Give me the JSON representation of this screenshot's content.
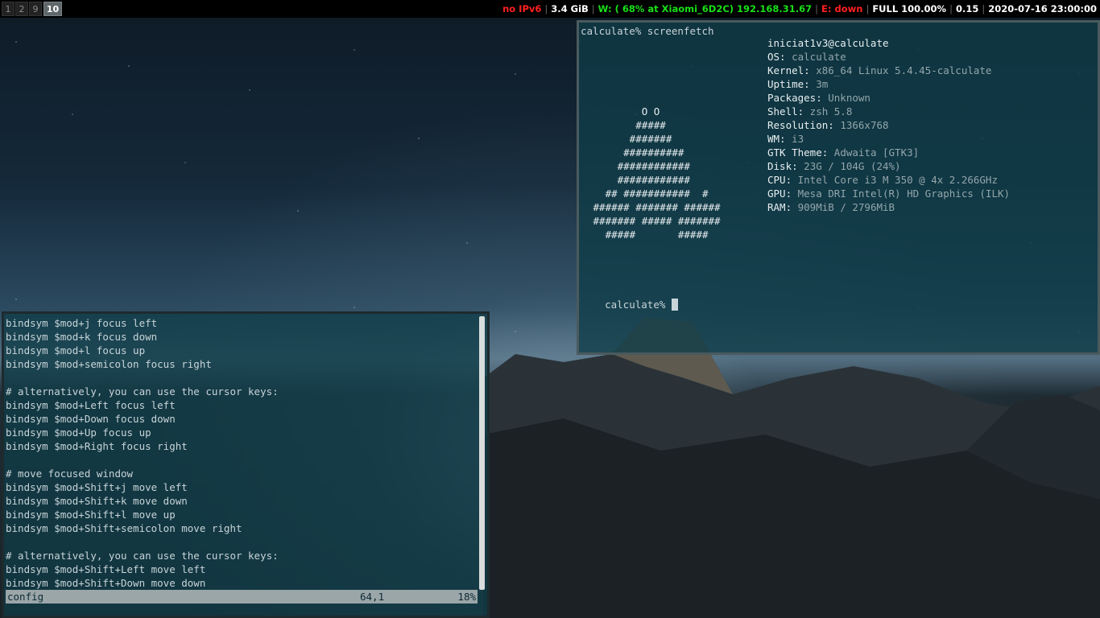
{
  "topbar": {
    "workspaces": [
      {
        "label": "1",
        "active": false
      },
      {
        "label": "2",
        "active": false
      },
      {
        "label": "9",
        "active": false
      },
      {
        "label": "10",
        "active": true
      }
    ],
    "status": {
      "ipv6": "no IPv6",
      "memory": "3.4 GiB",
      "wifi": "W: ( 68% at Xiaomi_6D2C) 192.168.31.67",
      "ethernet": "E: down",
      "battery": "FULL 100.00%",
      "load": "0.15",
      "datetime": "2020-07-16 23:00:00"
    }
  },
  "screenfetch": {
    "command_line": "calculate% screenfetch",
    "user_host": "iniciat1v3@calculate",
    "info": [
      {
        "key": "OS:",
        "value": " calculate"
      },
      {
        "key": "Kernel:",
        "value": " x86_64 Linux 5.4.45-calculate"
      },
      {
        "key": "Uptime:",
        "value": " 3m"
      },
      {
        "key": "Packages:",
        "value": " Unknown"
      },
      {
        "key": "Shell:",
        "value": " zsh 5.8"
      },
      {
        "key": "Resolution:",
        "value": " 1366x768"
      },
      {
        "key": "WM:",
        "value": " i3"
      },
      {
        "key": "GTK Theme:",
        "value": " Adwaita [GTK3]"
      },
      {
        "key": "Disk:",
        "value": " 23G / 104G (24%)"
      },
      {
        "key": "CPU:",
        "value": " Intel Core i3 M 350 @ 4x 2.266GHz"
      },
      {
        "key": "GPU:",
        "value": " Mesa DRI Intel(R) HD Graphics (ILK)"
      },
      {
        "key": "RAM:",
        "value": " 909MiB / 2796MiB"
      }
    ],
    "logo": [
      "         O O",
      "        #####",
      "       #######",
      "      ##########",
      "     ############",
      "     ############",
      "   ## ###########  #",
      " ###### ####### ######",
      " ####### ##### #######",
      "   #####       #####"
    ],
    "prompt": "calculate% "
  },
  "editor": {
    "lines": [
      "bindsym $mod+j focus left",
      "bindsym $mod+k focus down",
      "bindsym $mod+l focus up",
      "bindsym $mod+semicolon focus right",
      "",
      "# alternatively, you can use the cursor keys:",
      "bindsym $mod+Left focus left",
      "bindsym $mod+Down focus down",
      "bindsym $mod+Up focus up",
      "bindsym $mod+Right focus right",
      "",
      "# move focused window",
      "bindsym $mod+Shift+j move left",
      "bindsym $mod+Shift+k move down",
      "bindsym $mod+Shift+l move up",
      "bindsym $mod+Shift+semicolon move right",
      "",
      "# alternatively, you can use the cursor keys:",
      "bindsym $mod+Shift+Left move left",
      "bindsym $mod+Shift+Down move down"
    ],
    "status": {
      "filename": "config",
      "position": "64,1",
      "percent": "18%"
    }
  }
}
